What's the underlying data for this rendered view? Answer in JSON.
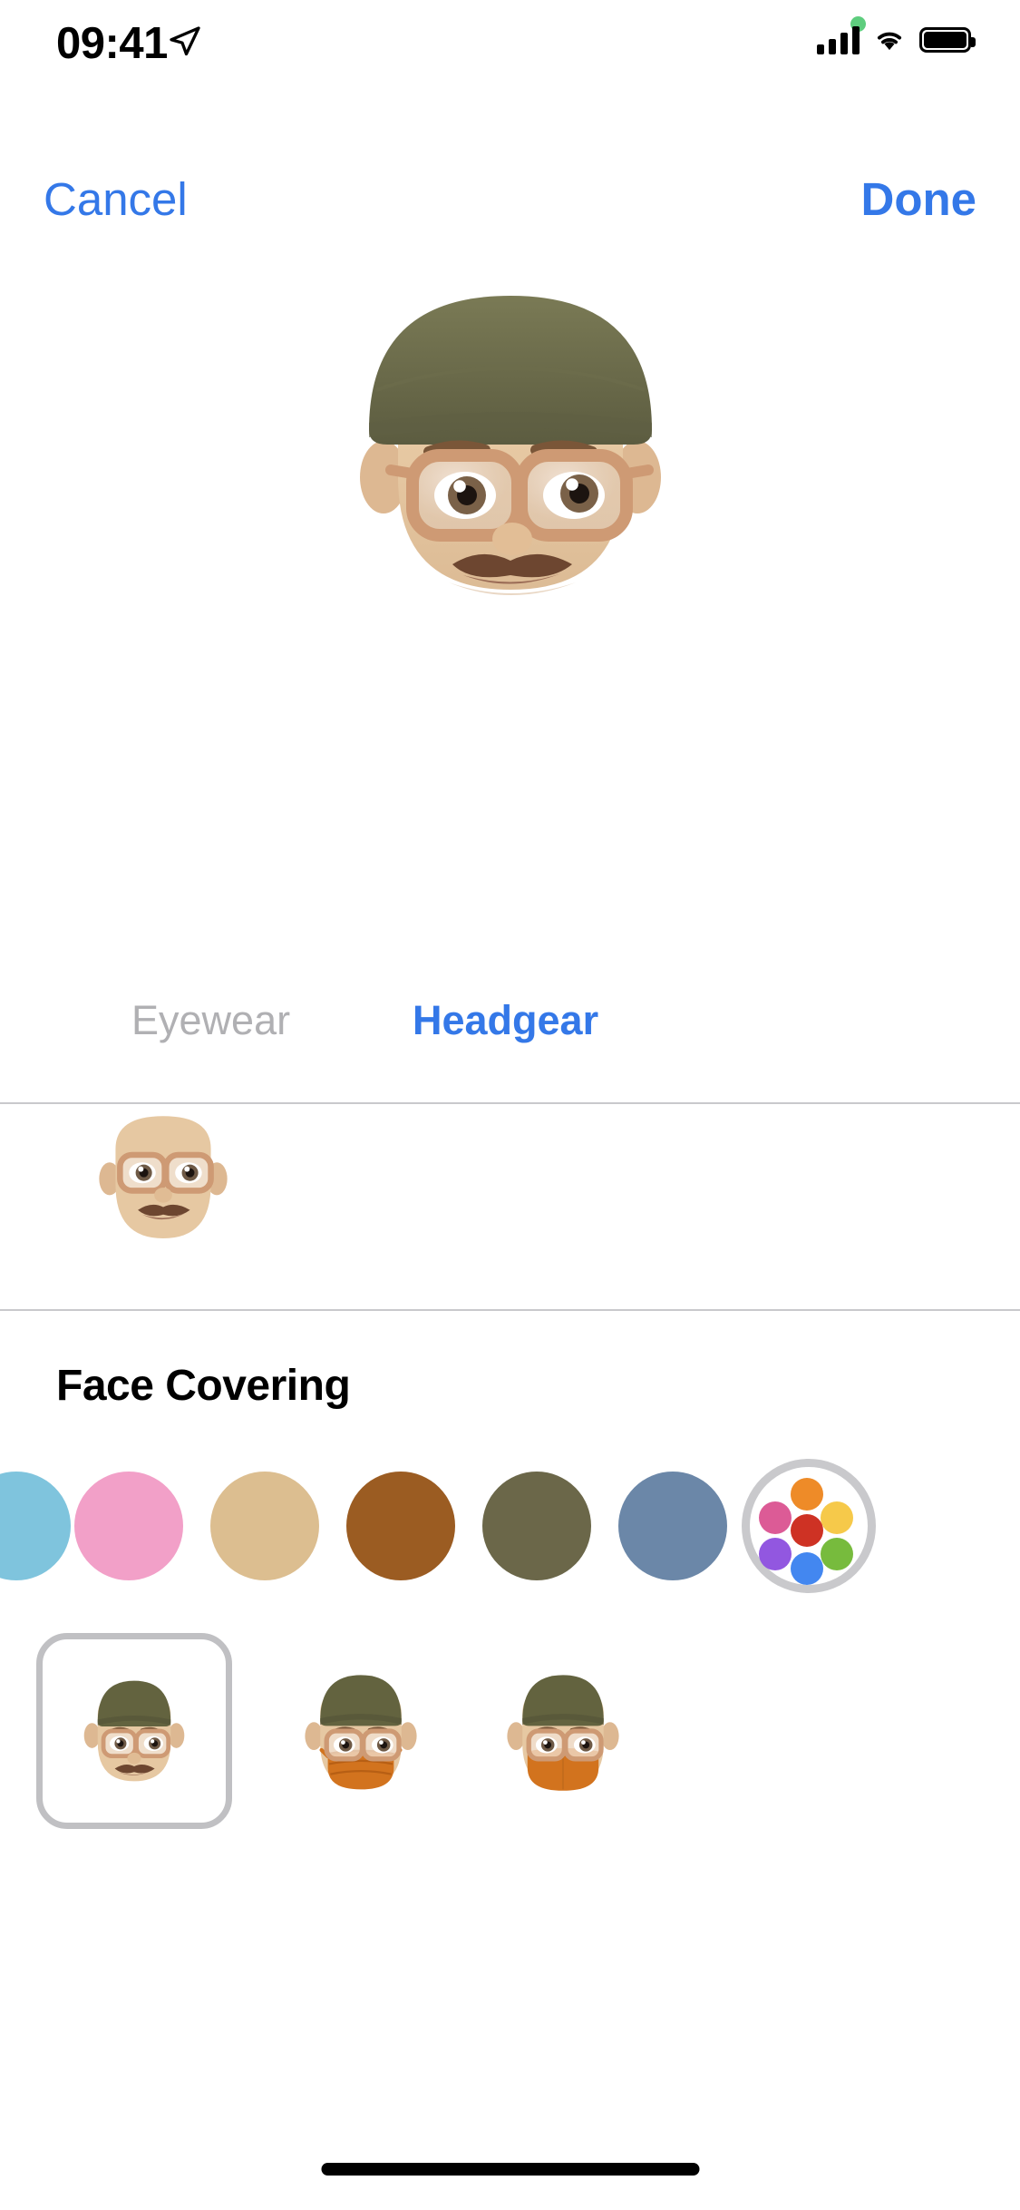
{
  "status_bar": {
    "time": "09:41",
    "location_icon": "location-arrow-icon",
    "recording_icon": "green-recording-dot",
    "cellular_icon": "cellular-signal-icon",
    "wifi_icon": "wifi-icon",
    "battery_icon": "battery-full-icon"
  },
  "navbar": {
    "cancel_label": "Cancel",
    "done_label": "Done",
    "accent_color": "#3478E8"
  },
  "preview": {
    "name": "memoji-preview",
    "description": "Memoji with olive beanie, blonde hair, tan glasses, brown mustache",
    "hat_color": "#6B6B4A",
    "hair_color": "#E6D07A",
    "skin_color": "#E6C49C",
    "glasses_color": "#D09B78",
    "mustache_color": "#6D4630"
  },
  "tabs": [
    {
      "label": "Eyewear",
      "active": false,
      "color": "#B0B0B3"
    },
    {
      "label": "Headgear",
      "active": true,
      "color": "#3478E8"
    }
  ],
  "eyewear_strip": {
    "name": "eyewear-option-row",
    "items": [
      {
        "name": "eyewear-option-glasses",
        "selected": false
      }
    ]
  },
  "section": {
    "title": "Face Covering"
  },
  "colors": {
    "swatches": [
      {
        "name": "swatch-light-blue",
        "hex": "#7FC4DD",
        "selected": false,
        "partial": true
      },
      {
        "name": "swatch-pink",
        "hex": "#F2A0C8",
        "selected": false
      },
      {
        "name": "swatch-tan",
        "hex": "#DCBE90",
        "selected": false
      },
      {
        "name": "swatch-brown",
        "hex": "#9B5C22",
        "selected": false
      },
      {
        "name": "swatch-olive",
        "hex": "#6B6749",
        "selected": false
      },
      {
        "name": "swatch-slate-blue",
        "hex": "#6B87A8",
        "selected": false
      }
    ],
    "custom_picker": {
      "name": "custom-color-picker",
      "ring_color": "#C9C9CC",
      "dots": [
        {
          "name": "dot-orange",
          "hex": "#EE8B28"
        },
        {
          "name": "dot-yellow",
          "hex": "#F6C council"
        },
        {
          "name": "dot-pink",
          "hex": "#DC5B96"
        },
        {
          "name": "dot-red",
          "hex": "#CE3224"
        },
        {
          "name": "dot-green",
          "hex": "#77BB3D"
        },
        {
          "name": "dot-purple",
          "hex": "#9257E0"
        },
        {
          "name": "dot-blue",
          "hex": "#4387F0"
        }
      ]
    }
  },
  "face_coverings": [
    {
      "name": "face-covering-none",
      "label": "None",
      "selected": true,
      "mask": "none"
    },
    {
      "name": "face-covering-pleated-mask",
      "label": "Pleated Mask",
      "selected": false,
      "mask": "pleated",
      "mask_color": "#D2731E"
    },
    {
      "name": "face-covering-smooth-mask",
      "label": "Smooth Mask",
      "selected": false,
      "mask": "smooth",
      "mask_color": "#D2731E"
    }
  ],
  "home_indicator": {
    "name": "home-indicator"
  }
}
